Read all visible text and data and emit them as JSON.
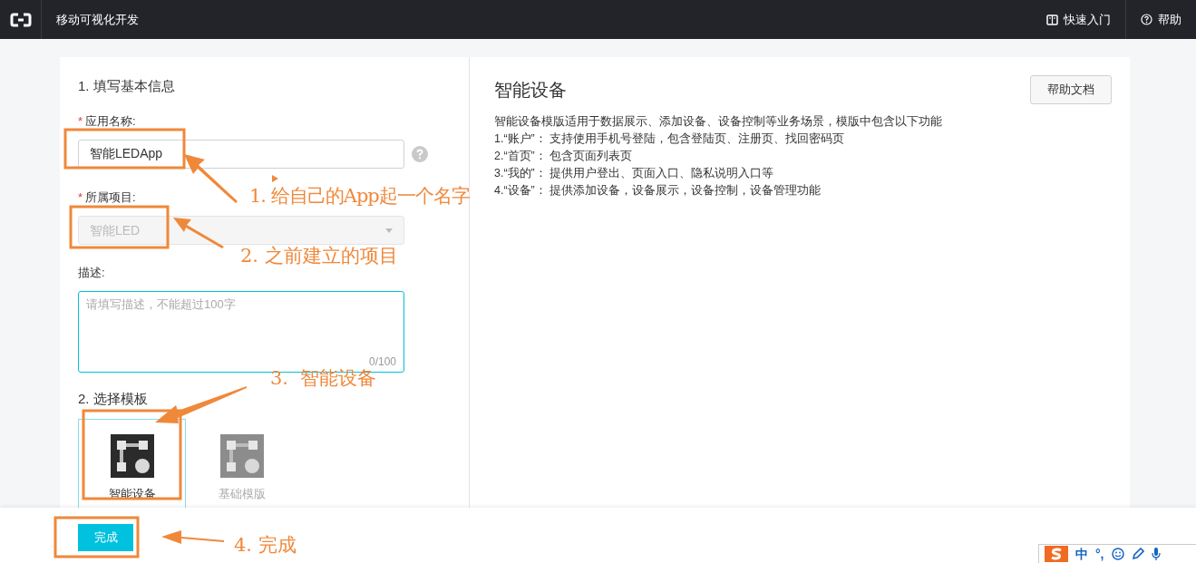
{
  "topbar": {
    "title": "移动可视化开发",
    "links": [
      {
        "kind": "book",
        "label": "快速入门"
      },
      {
        "kind": "help",
        "label": "帮助"
      }
    ]
  },
  "form": {
    "section_title": "1. 填写基本信息",
    "name_field": {
      "label": "应用名称:",
      "required_mark": "*",
      "value": "智能LEDApp"
    },
    "project_field": {
      "label": "所属项目:",
      "required_mark": "*",
      "value": "智能LED",
      "disabled": true
    },
    "description_field": {
      "label": "描述:",
      "placeholder": "请填写描述，不能超过100字",
      "counter": "0/100",
      "focused": true
    },
    "template_title": "2. 选择模板",
    "templates": [
      {
        "label": "智能设备",
        "selected": true
      },
      {
        "label": "基础模版",
        "selected": false
      }
    ]
  },
  "detail": {
    "title": "智能设备",
    "help_button": "帮助文档",
    "lines": [
      "智能设备模版适用于数据展示、添加设备、设备控制等业务场景，模版中包含以下功能",
      "1.“账户”： 支持使用手机号登陆，包含登陆页、注册页、找回密码页",
      "2.“首页”： 包含页面列表页",
      "3.“我的”： 提供用户登出、页面入口、隐私说明入口等",
      "4.“设备”：  提供添加设备，设备展示，设备控制，设备管理功能"
    ]
  },
  "footer": {
    "submit": "完成"
  },
  "ime_toolbar": [
    {
      "kind": "logo"
    },
    {
      "kind": "text",
      "label": "中"
    },
    {
      "kind": "text",
      "label": "°,"
    },
    {
      "kind": "smiley"
    },
    {
      "kind": "pen"
    },
    {
      "kind": "mic"
    }
  ],
  "annotations": [
    {
      "kind": "callout",
      "label": "1. 给自己的App起一个名字"
    },
    {
      "kind": "callout",
      "label": "2. 之前建立的项目"
    },
    {
      "kind": "callout",
      "label": "3.  智能设备"
    },
    {
      "kind": "callout",
      "label": "4. 完成"
    }
  ]
}
